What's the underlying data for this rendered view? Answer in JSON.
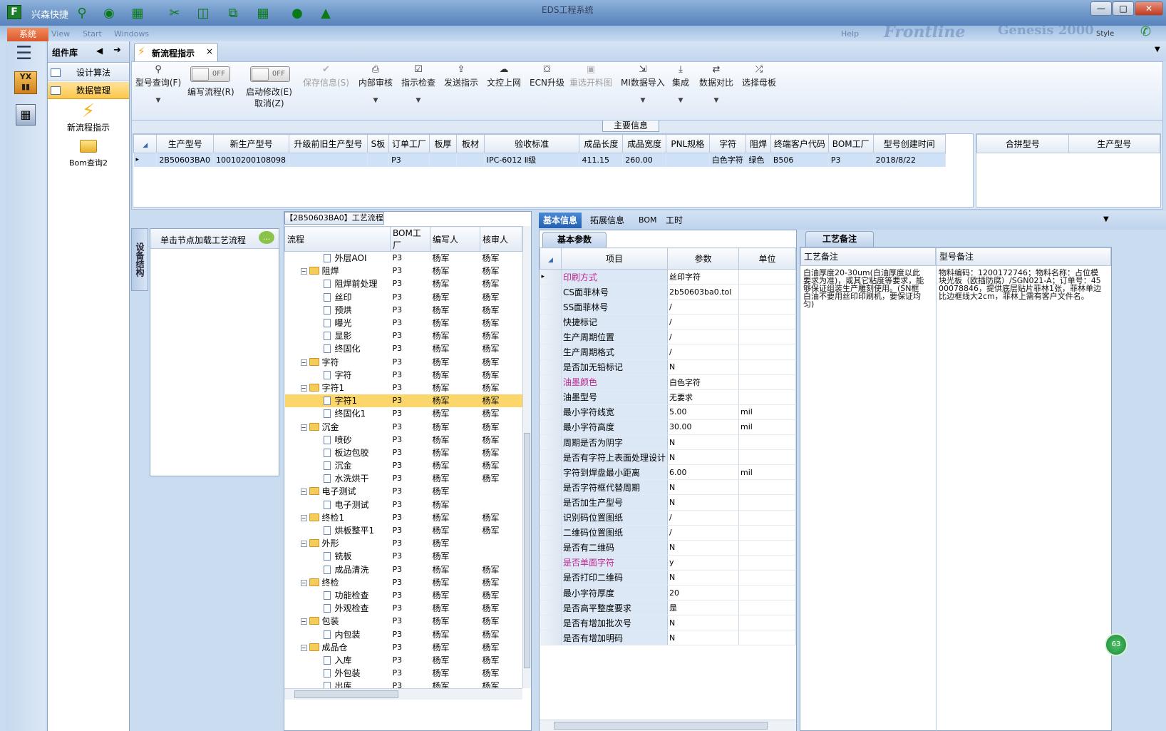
{
  "titlebar": {
    "app_name": "兴森快捷",
    "window_title": "EDS工程系统",
    "controls": [
      "—",
      "□",
      "✕"
    ],
    "system_tab": "系统",
    "menu_items": [
      "View",
      "Start",
      "Windows",
      "Help"
    ],
    "brand_left": "Frontline",
    "brand_right": "Genesis 2000",
    "style_label": "Style"
  },
  "nav": {
    "menu_icon": "hamburger-icon",
    "side_icons": [
      "factory-icon",
      "calculator-icon"
    ],
    "component_lib_title": "组件库",
    "lib_items": [
      {
        "label": "设计算法",
        "selected": false
      },
      {
        "label": "数据管理",
        "selected": true
      }
    ],
    "big_items": [
      {
        "label": "新流程指示",
        "icon": "lightning-icon"
      },
      {
        "label": "Bom查询2",
        "icon": "folder-icon"
      }
    ]
  },
  "doc_tab": {
    "label": "新流程指示",
    "close": "×"
  },
  "ribbon": {
    "query": "型号查询(F)",
    "edit_flow": "编写流程(R)",
    "edit_toggle": "OFF",
    "start_modify": "启动修改(E)",
    "start_toggle": "OFF",
    "cancel": "取消(Z)",
    "buttons": [
      {
        "label": "保存信息(S)",
        "disabled": true,
        "icon": "✔"
      },
      {
        "label": "内部审核",
        "disabled": false,
        "icon": "⎙"
      },
      {
        "label": "指示检查",
        "disabled": false,
        "icon": "☑"
      },
      {
        "label": "发送指示",
        "disabled": false,
        "icon": "⇪"
      },
      {
        "label": "文控上网",
        "disabled": false,
        "icon": "☁"
      },
      {
        "label": "ECN升级",
        "disabled": false,
        "icon": "⛋"
      },
      {
        "label": "重选开料图",
        "disabled": true,
        "icon": "▣"
      },
      {
        "label": "MI数据导入",
        "disabled": false,
        "icon": "⇲"
      },
      {
        "label": "集成",
        "disabled": false,
        "icon": "⤓"
      },
      {
        "label": "数据对比",
        "disabled": false,
        "icon": "⇄"
      },
      {
        "label": "选择母板",
        "disabled": false,
        "icon": "⤮"
      }
    ]
  },
  "main_info": {
    "title": "主要信息",
    "columns": [
      "生产型号",
      "新生产型号",
      "升级前旧生产型号",
      "S板",
      "订单工厂",
      "板厚",
      "板材",
      "验收标准",
      "成品长度",
      "成品宽度",
      "PNL规格",
      "字符",
      "阻焊",
      "终端客户代码",
      "BOM工厂",
      "型号创建时间"
    ],
    "rows": [
      [
        "2B50603BA0",
        "10010200108098",
        "",
        "",
        "P3",
        "",
        "",
        "IPC-6012 Ⅱ级",
        "411.15",
        "260.00",
        "",
        "白色字符",
        "绿色",
        "B506",
        "P3",
        "2018/8/22"
      ]
    ],
    "side_columns": [
      "合拼型号",
      "生产型号"
    ]
  },
  "left_panel": {
    "side_tab": "设备结构",
    "load_hint": "单击节点加载工艺流程"
  },
  "flow": {
    "caption": "【2B50603BA0】工艺流程",
    "columns": [
      "流程",
      "BOM工厂",
      "编写人",
      "核审人"
    ],
    "rows": [
      {
        "name": "外层AOI",
        "lvl": 1,
        "f": "P3",
        "w": "杨军",
        "r": "杨军"
      },
      {
        "name": "阻焊",
        "lvl": 0,
        "f": "P3",
        "w": "杨军",
        "r": "杨军"
      },
      {
        "name": "阻焊前处理",
        "lvl": 1,
        "f": "P3",
        "w": "杨军",
        "r": "杨军"
      },
      {
        "name": "丝印",
        "lvl": 1,
        "f": "P3",
        "w": "杨军",
        "r": "杨军"
      },
      {
        "name": "预烘",
        "lvl": 1,
        "f": "P3",
        "w": "杨军",
        "r": "杨军"
      },
      {
        "name": "曝光",
        "lvl": 1,
        "f": "P3",
        "w": "杨军",
        "r": "杨军"
      },
      {
        "name": "显影",
        "lvl": 1,
        "f": "P3",
        "w": "杨军",
        "r": "杨军"
      },
      {
        "name": "终固化",
        "lvl": 1,
        "f": "P3",
        "w": "杨军",
        "r": "杨军"
      },
      {
        "name": "字符",
        "lvl": 0,
        "f": "P3",
        "w": "杨军",
        "r": "杨军"
      },
      {
        "name": "字符",
        "lvl": 1,
        "f": "P3",
        "w": "杨军",
        "r": "杨军"
      },
      {
        "name": "字符1",
        "lvl": 0,
        "f": "P3",
        "w": "杨军",
        "r": "杨军"
      },
      {
        "name": "字符1",
        "lvl": 1,
        "f": "P3",
        "w": "杨军",
        "r": "杨军",
        "hl": true
      },
      {
        "name": "终固化1",
        "lvl": 1,
        "f": "P3",
        "w": "杨军",
        "r": "杨军"
      },
      {
        "name": "沉金",
        "lvl": 0,
        "f": "P3",
        "w": "杨军",
        "r": "杨军"
      },
      {
        "name": "喷砂",
        "lvl": 1,
        "f": "P3",
        "w": "杨军",
        "r": "杨军"
      },
      {
        "name": "板边包胶",
        "lvl": 1,
        "f": "P3",
        "w": "杨军",
        "r": "杨军"
      },
      {
        "name": "沉金",
        "lvl": 1,
        "f": "P3",
        "w": "杨军",
        "r": "杨军"
      },
      {
        "name": "水洗烘干",
        "lvl": 1,
        "f": "P3",
        "w": "杨军",
        "r": "杨军"
      },
      {
        "name": "电子测试",
        "lvl": 0,
        "f": "P3",
        "w": "杨军",
        "r": ""
      },
      {
        "name": "电子测试",
        "lvl": 1,
        "f": "P3",
        "w": "杨军",
        "r": ""
      },
      {
        "name": "终检1",
        "lvl": 0,
        "f": "P3",
        "w": "杨军",
        "r": "杨军"
      },
      {
        "name": "烘板整平1",
        "lvl": 1,
        "f": "P3",
        "w": "杨军",
        "r": "杨军"
      },
      {
        "name": "外形",
        "lvl": 0,
        "f": "P3",
        "w": "杨军",
        "r": ""
      },
      {
        "name": "铣板",
        "lvl": 1,
        "f": "P3",
        "w": "杨军",
        "r": ""
      },
      {
        "name": "成品清洗",
        "lvl": 1,
        "f": "P3",
        "w": "杨军",
        "r": "杨军"
      },
      {
        "name": "终检",
        "lvl": 0,
        "f": "P3",
        "w": "杨军",
        "r": "杨军"
      },
      {
        "name": "功能检查",
        "lvl": 1,
        "f": "P3",
        "w": "杨军",
        "r": "杨军"
      },
      {
        "name": "外观检查",
        "lvl": 1,
        "f": "P3",
        "w": "杨军",
        "r": "杨军"
      },
      {
        "name": "包装",
        "lvl": 0,
        "f": "P3",
        "w": "杨军",
        "r": "杨军"
      },
      {
        "name": "内包装",
        "lvl": 1,
        "f": "P3",
        "w": "杨军",
        "r": "杨军"
      },
      {
        "name": "成品仓",
        "lvl": 0,
        "f": "P3",
        "w": "杨军",
        "r": "杨军"
      },
      {
        "name": "入库",
        "lvl": 1,
        "f": "P3",
        "w": "杨军",
        "r": "杨军"
      },
      {
        "name": "外包装",
        "lvl": 1,
        "f": "P3",
        "w": "杨军",
        "r": "杨军"
      },
      {
        "name": "出库",
        "lvl": 1,
        "f": "P3",
        "w": "杨军",
        "r": "杨军"
      }
    ]
  },
  "info_tabs": [
    "基本信息",
    "拓展信息",
    "BOM",
    "工时"
  ],
  "basic_params": {
    "title": "基本参数",
    "columns": [
      "项目",
      "参数",
      "单位"
    ],
    "rows": [
      {
        "item": "印刷方式",
        "val": "丝印字符",
        "unit": "",
        "pink": true
      },
      {
        "item": "CS面菲林号",
        "val": "2b50603ba0.tol",
        "unit": ""
      },
      {
        "item": "SS面菲林号",
        "val": "/",
        "unit": ""
      },
      {
        "item": "快捷标记",
        "val": "/",
        "unit": ""
      },
      {
        "item": "生产周期位置",
        "val": "/",
        "unit": ""
      },
      {
        "item": "生产周期格式",
        "val": "/",
        "unit": ""
      },
      {
        "item": "是否加无铅标记",
        "val": "N",
        "unit": ""
      },
      {
        "item": "油墨颜色",
        "val": "白色字符",
        "unit": "",
        "pink": true
      },
      {
        "item": "油墨型号",
        "val": "无要求",
        "unit": ""
      },
      {
        "item": "最小字符线宽",
        "val": "5.00",
        "unit": "mil"
      },
      {
        "item": "最小字符高度",
        "val": "30.00",
        "unit": "mil"
      },
      {
        "item": "周期是否为阴字",
        "val": "N",
        "unit": ""
      },
      {
        "item": "是否有字符上表面处理设计",
        "val": "N",
        "unit": ""
      },
      {
        "item": "字符到焊盘最小距离",
        "val": "6.00",
        "unit": "mil"
      },
      {
        "item": "是否字符框代替周期",
        "val": "N",
        "unit": ""
      },
      {
        "item": "是否加生产型号",
        "val": "N",
        "unit": ""
      },
      {
        "item": "识别码位置图纸",
        "val": "/",
        "unit": ""
      },
      {
        "item": "二维码位置图纸",
        "val": "/",
        "unit": ""
      },
      {
        "item": "是否有二维码",
        "val": "N",
        "unit": ""
      },
      {
        "item": "是否单面字符",
        "val": "y",
        "unit": "",
        "pink": true
      },
      {
        "item": "是否打印二维码",
        "val": "N",
        "unit": ""
      },
      {
        "item": "最小字符厚度",
        "val": "20",
        "unit": ""
      },
      {
        "item": "是否高平整度要求",
        "val": "是",
        "unit": ""
      },
      {
        "item": "是否有增加批次号",
        "val": "N",
        "unit": ""
      },
      {
        "item": "是否有增加明码",
        "val": "N",
        "unit": ""
      }
    ]
  },
  "notes": {
    "title": "工艺备注",
    "col1": "工艺备注",
    "col2": "型号备注",
    "process_note": "白油厚度20-30um(白油厚度以此要求为准)，或其它粘度等要求，能够保证组装生产雕刻使用。(SN框白油不要用丝印印刷机，要保证均匀)",
    "model_note": "物料编码：1200172746；物料名称：占位模块光板（欧插防腐）/SGN021-A；订单号：4500078846，提供底层贴片菲林1张，菲林单边比边框线大2cm，菲林上需有客户文件名。"
  },
  "badge": "63"
}
